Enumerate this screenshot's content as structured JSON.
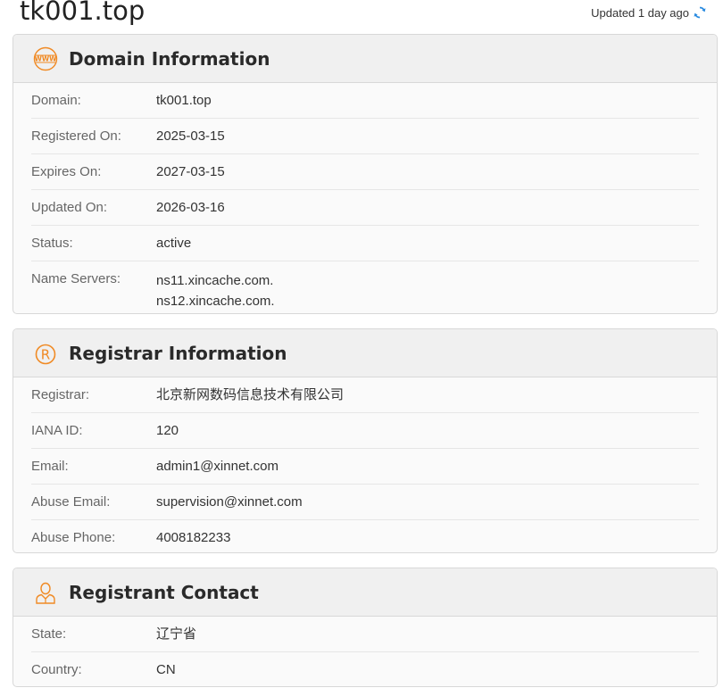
{
  "page": {
    "title": "tk001.top",
    "updated": "Updated 1 day ago"
  },
  "colors": {
    "accent": "#f08a24",
    "refresh": "#2a8be0"
  },
  "domain_info": {
    "title": "Domain Information",
    "icon": "www-icon",
    "rows": [
      {
        "label": "Domain:",
        "value": "tk001.top"
      },
      {
        "label": "Registered On:",
        "value": "2025-03-15"
      },
      {
        "label": "Expires On:",
        "value": "2027-03-15"
      },
      {
        "label": "Updated On:",
        "value": "2026-03-16"
      },
      {
        "label": "Status:",
        "value": "active"
      },
      {
        "label": "Name Servers:",
        "values": [
          "ns11.xincache.com.",
          "ns12.xincache.com."
        ]
      }
    ]
  },
  "registrar_info": {
    "title": "Registrar Information",
    "icon": "registered-icon",
    "rows": [
      {
        "label": "Registrar:",
        "value": "北京新网数码信息技术有限公司"
      },
      {
        "label": "IANA ID:",
        "value": "120"
      },
      {
        "label": "Email:",
        "value": "admin1@xinnet.com"
      },
      {
        "label": "Abuse Email:",
        "value": "supervision@xinnet.com"
      },
      {
        "label": "Abuse Phone:",
        "value": "4008182233"
      }
    ]
  },
  "registrant_contact": {
    "title": "Registrant Contact",
    "icon": "person-icon",
    "rows": [
      {
        "label": "State:",
        "value": "辽宁省"
      },
      {
        "label": "Country:",
        "value": "CN"
      }
    ]
  }
}
